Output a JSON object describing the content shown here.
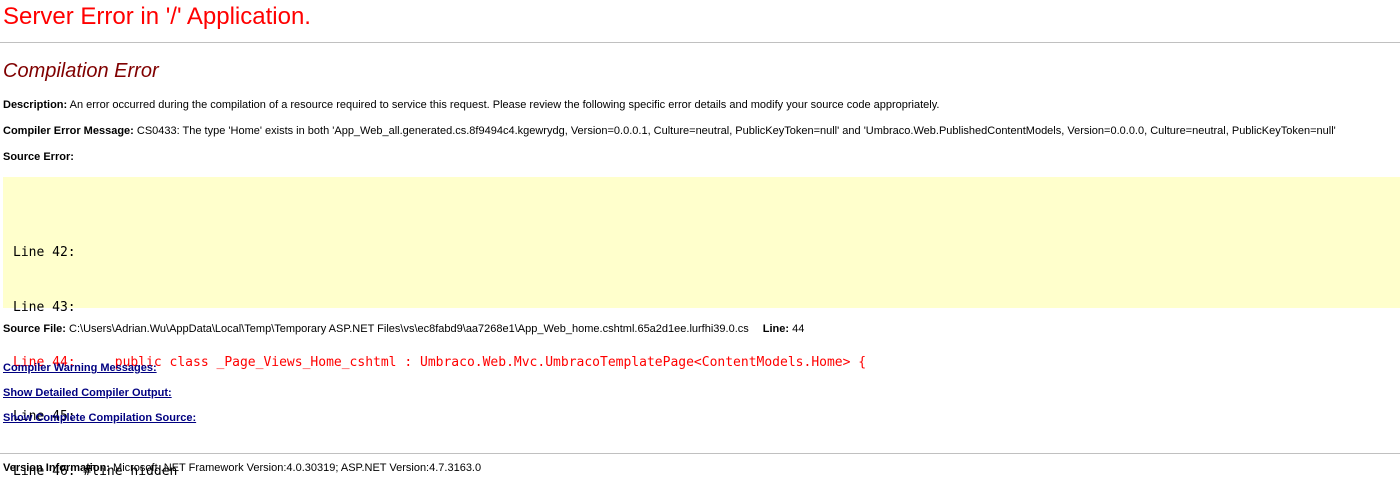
{
  "page": {
    "title": "Server Error in '/' Application.",
    "subtitle": "Compilation Error"
  },
  "description": {
    "label": "Description:",
    "text": " An error occurred during the compilation of a resource required to service this request. Please review the following specific error details and modify your source code appropriately."
  },
  "compiler_error": {
    "label": "Compiler Error Message:",
    "text": " CS0433: The type 'Home' exists in both 'App_Web_all.generated.cs.8f9494c4.kgewrydg, Version=0.0.0.1, Culture=neutral, PublicKeyToken=null' and 'Umbraco.Web.PublishedContentModels, Version=0.0.0.0, Culture=neutral, PublicKeyToken=null'"
  },
  "source_error": {
    "label": "Source Error:",
    "lines": [
      {
        "text": "Line 42:",
        "is_error": false
      },
      {
        "text": "Line 43:",
        "is_error": false
      },
      {
        "text": "Line 44:     public class _Page_Views_Home_cshtml : Umbraco.Web.Mvc.UmbracoTemplatePage<ContentModels.Home> {",
        "is_error": true
      },
      {
        "text": "Line 45:",
        "is_error": false
      },
      {
        "text": "Line 46: #line hidden",
        "is_error": false
      }
    ]
  },
  "source_file": {
    "label": "Source File:",
    "path": " C:\\Users\\Adrian.Wu\\AppData\\Local\\Temp\\Temporary ASP.NET Files\\vs\\ec8fabd9\\aa7268e1\\App_Web_home.cshtml.65a2d1ee.lurfhi39.0.cs",
    "line_label": "Line:",
    "line_value": " 44"
  },
  "links": {
    "warnings": "Compiler Warning Messages:",
    "detailed_output": "Show Detailed Compiler Output:",
    "complete_source": "Show Complete Compilation Source:"
  },
  "version": {
    "label": "Version Information:",
    "text": " Microsoft .NET Framework Version:4.0.30319; ASP.NET Version:4.7.3163.0"
  },
  "colors": {
    "title": "#ff0000",
    "subtitle": "#800000",
    "code_background": "#ffffcc",
    "error_line": "#ff0000",
    "link": "#000080",
    "rule": "#c0c0c0"
  }
}
